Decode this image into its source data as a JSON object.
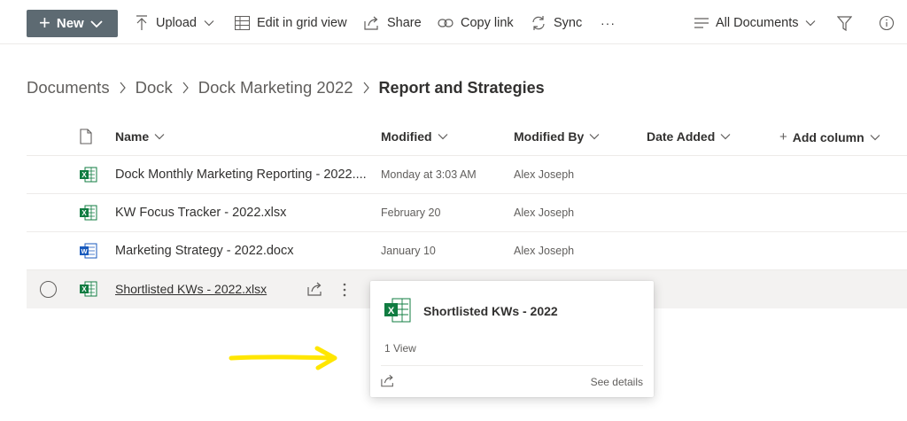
{
  "toolbar": {
    "new_label": "New",
    "upload_label": "Upload",
    "edit_grid_label": "Edit in grid view",
    "share_label": "Share",
    "copy_link_label": "Copy link",
    "sync_label": "Sync",
    "more_label": "···",
    "view_label": "All Documents"
  },
  "breadcrumb": {
    "items": [
      "Documents",
      "Dock",
      "Dock Marketing 2022"
    ],
    "current": "Report and Strategies"
  },
  "table": {
    "columns": {
      "name": "Name",
      "modified": "Modified",
      "modified_by": "Modified By",
      "date_added": "Date Added",
      "add_column": "Add column"
    },
    "rows": [
      {
        "name": "Dock Monthly Marketing Reporting - 2022....",
        "modified": "Monday at 3:03 AM",
        "modified_by": "Alex Joseph",
        "type": "excel"
      },
      {
        "name": "KW Focus Tracker - 2022.xlsx",
        "modified": "February 20",
        "modified_by": "Alex Joseph",
        "type": "excel"
      },
      {
        "name": "Marketing Strategy - 2022.docx",
        "modified": "January 10",
        "modified_by": "Alex Joseph",
        "type": "word"
      },
      {
        "name": "Shortlisted KWs - 2022.xlsx",
        "modified": "",
        "modified_by": "",
        "type": "excel"
      }
    ]
  },
  "hover_card": {
    "title": "Shortlisted KWs - 2022",
    "views": "1 View",
    "details_label": "See details"
  },
  "colors": {
    "new_button": "#5d6a72",
    "excel": "#107c41",
    "word": "#185abd",
    "annotation_arrow": "#ffe600"
  }
}
